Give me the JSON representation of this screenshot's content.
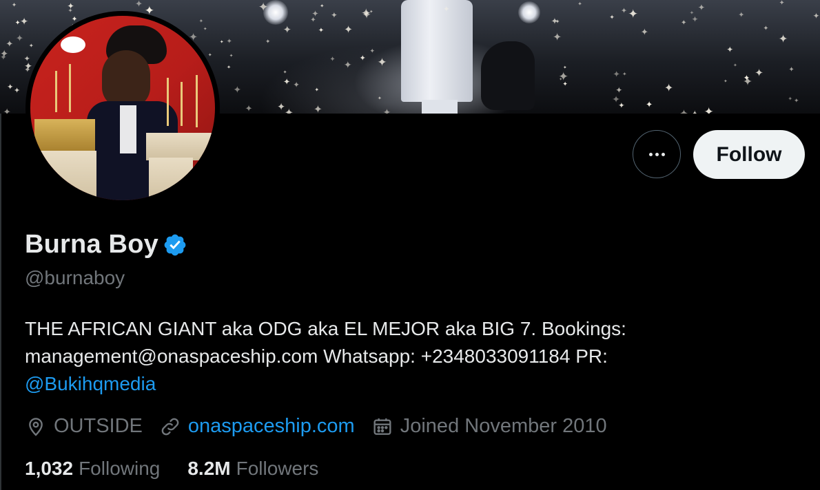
{
  "profile": {
    "display_name": "Burna Boy",
    "handle": "@burnaboy",
    "bio_line1": "THE AFRICAN GIANT aka ODG aka EL MEJOR aka BIG 7. Bookings:",
    "bio_line2": "management@onaspaceship.com Whatsapp: +2348033091184 PR:",
    "bio_mention": "@Bukihqmedia",
    "location": "OUTSIDE",
    "website": "onaspaceship.com",
    "joined": "Joined November 2010"
  },
  "actions": {
    "more_icon": "more-horizontal-icon",
    "follow_label": "Follow"
  },
  "stats": {
    "following_count": "1,032",
    "following_label": "Following",
    "followers_count": "8.2M",
    "followers_label": "Followers"
  },
  "icons": {
    "verified": "verified-badge-icon",
    "location": "location-pin-icon",
    "link": "link-icon",
    "calendar": "calendar-icon"
  },
  "colors": {
    "background": "#000000",
    "text_primary": "#e7e9ea",
    "text_secondary": "#71767b",
    "link": "#1d9bf0",
    "verified": "#1d9bf0",
    "follow_button_bg": "#eff3f4"
  }
}
